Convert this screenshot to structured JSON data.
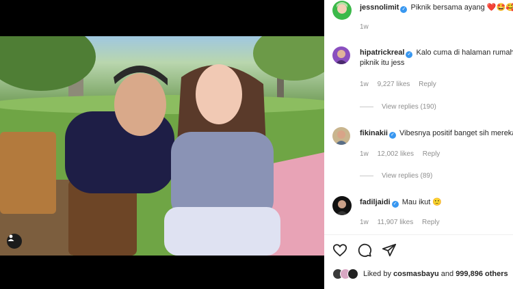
{
  "post": {
    "author": "jessnolimit",
    "caption": "Piknik bersama ayang ❤️🤩🥰",
    "time": "1w"
  },
  "comments": [
    {
      "username": "hipatrickreal",
      "verified": true,
      "text": "Kalo cuma di halaman rumah s",
      "text2": "piknik itu jess",
      "time": "1w",
      "likes": "9,227 likes",
      "reply": "Reply",
      "view_replies": "View replies (190)"
    },
    {
      "username": "fikinakii",
      "verified": true,
      "text": "Vibesnya positif banget sih mereka,",
      "time": "1w",
      "likes": "12,002 likes",
      "reply": "Reply",
      "view_replies": "View replies (89)"
    },
    {
      "username": "fadiljaidi",
      "verified": true,
      "text": "Mau ikut 🙂",
      "time": "1w",
      "likes": "11,907 likes",
      "reply": "Reply"
    }
  ],
  "likes": {
    "prefix": "Liked by",
    "user": "cosmasbayu",
    "and": "and",
    "others": "999,896 others"
  },
  "icons": {
    "verified": "verified-badge-icon",
    "like": "heart-icon",
    "comment": "comment-icon",
    "share": "share-icon",
    "user_tag": "user-tag-icon"
  },
  "colors": {
    "verified": "#3897f0",
    "muted": "#8e8e8e",
    "picnic_blanket": "#e8a3b6"
  }
}
